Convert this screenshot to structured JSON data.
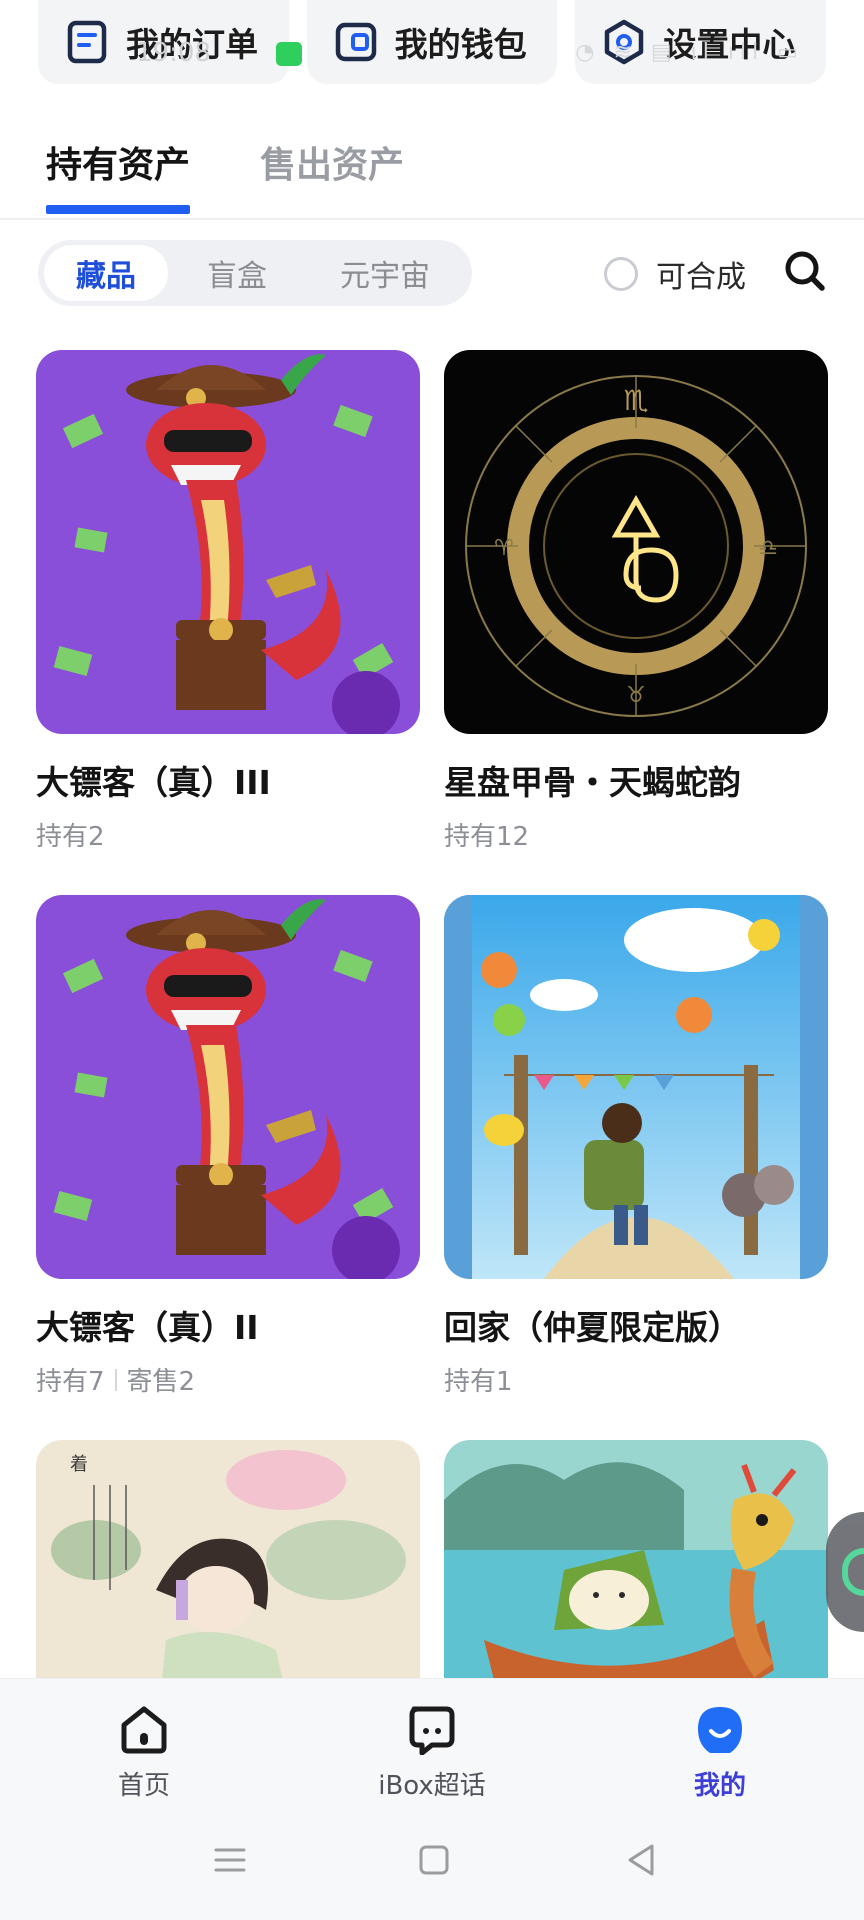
{
  "shortcuts": [
    {
      "label": "我的订单",
      "icon": "order-list-icon"
    },
    {
      "label": "我的钱包",
      "icon": "wallet-icon"
    },
    {
      "label": "设置中心",
      "icon": "settings-icon"
    }
  ],
  "status_bar": {
    "time": "19:08"
  },
  "main_tabs": [
    {
      "label": "持有资产",
      "active": true
    },
    {
      "label": "售出资产",
      "active": false
    }
  ],
  "filter": {
    "segments": [
      {
        "label": "藏品",
        "active": true
      },
      {
        "label": "盲盒",
        "active": false
      },
      {
        "label": "元宇宙",
        "active": false
      }
    ],
    "synthesizable_label": "可合成",
    "synthesizable_checked": false
  },
  "items": [
    {
      "name": "大镖客（真）III",
      "holding": "持有2",
      "consign": "",
      "image": "cowboy-snake-art"
    },
    {
      "name": "星盘甲骨・天蝎蛇韵",
      "holding": "持有12",
      "consign": "",
      "image": "zodiac-wheel-art"
    },
    {
      "name": "大镖客（真）II",
      "holding": "持有7",
      "consign": "寄售2",
      "image": "cowboy-snake-art"
    },
    {
      "name": "回家（仲夏限定版）",
      "holding": "持有1",
      "consign": "",
      "image": "going-home-art"
    },
    {
      "name": "",
      "holding": "",
      "consign": "",
      "image": "lotus-girl-art"
    },
    {
      "name": "",
      "holding": "",
      "consign": "",
      "image": "dragon-boat-zongzi-art"
    }
  ],
  "bottom_nav": [
    {
      "label": "首页",
      "icon": "home-icon",
      "active": false
    },
    {
      "label": "iBox超话",
      "icon": "chat-icon",
      "active": false
    },
    {
      "label": "我的",
      "icon": "profile-icon",
      "active": true
    }
  ],
  "colors": {
    "accent": "#1f5ef0",
    "active_nav": "#3d3fd6"
  }
}
